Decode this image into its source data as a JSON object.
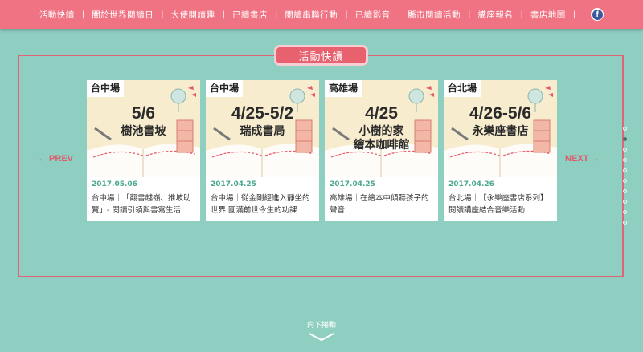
{
  "nav": {
    "items": [
      "活動快讀",
      "關於世界閱讀日",
      "大使閱讀趣",
      "已讀書店",
      "閱讀串聯行動",
      "已讀影音",
      "縣市閱讀活動",
      "講座報名",
      "書店地圖"
    ],
    "separator": "|",
    "facebook_icon": "facebook-icon"
  },
  "section": {
    "title": "活動快讀"
  },
  "carousel": {
    "prev_label": "← PREV",
    "next_label": "NEXT →",
    "dots_count": 10,
    "active_dot": 1
  },
  "cards": [
    {
      "city": "台中場",
      "big_date": "5/6",
      "venue": "樹池書坡",
      "date": "2017.05.06",
      "desc": "台中場｜「翻書越嶺、推坡助覽」- 閱讀引領與書寫生活"
    },
    {
      "city": "台中場",
      "big_date": "4/25-5/2",
      "venue": "瑞成書局",
      "date": "2017.04.25",
      "desc": "台中場｜從金剛經進入靜坐的世界 圓滿前世今生的功課"
    },
    {
      "city": "高雄場",
      "big_date": "4/25",
      "venue": "小樹的家\n繪本咖啡館",
      "date": "2017.04.25",
      "desc": "高雄場｜在繪本中傾聽孩子的聲音"
    },
    {
      "city": "台北場",
      "big_date": "4/26-5/6",
      "venue": "永樂座書店",
      "date": "2017.04.26",
      "desc": "台北場｜【永樂座書店系列】閱讀講座結合音樂活動"
    }
  ],
  "scroll_hint": {
    "label": "向下捲動"
  },
  "colors": {
    "nav_bg": "#f07383",
    "page_bg": "#8fcfc2",
    "accent": "#e36377",
    "date_green": "#4ca890"
  }
}
